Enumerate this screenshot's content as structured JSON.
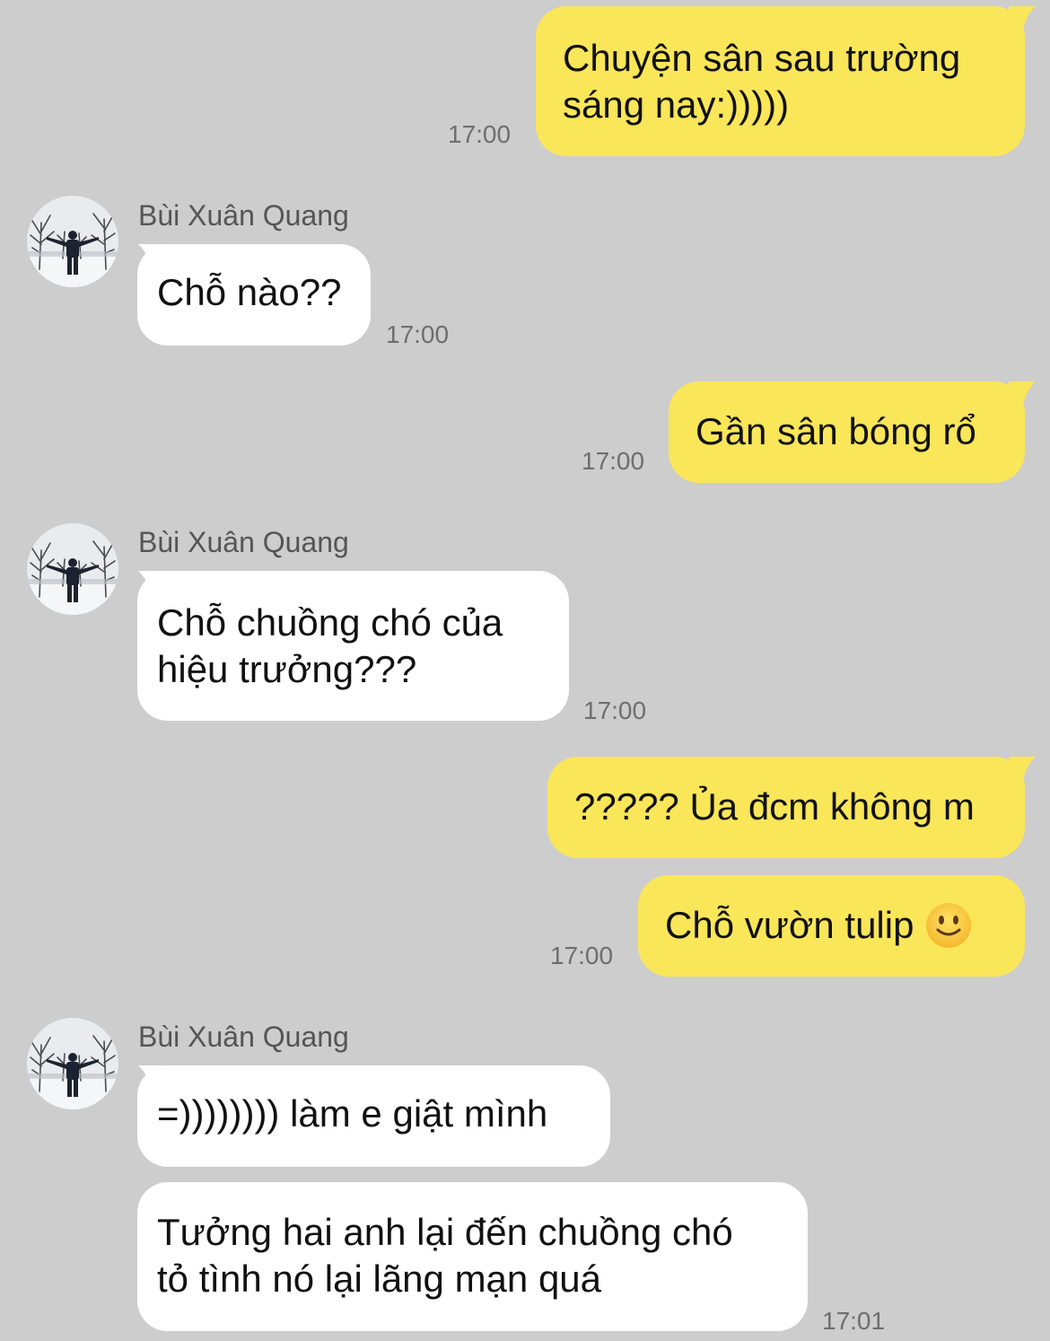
{
  "colors": {
    "background": "#cdcdcd",
    "outgoing_bubble": "#fae659",
    "incoming_bubble": "#ffffff",
    "timestamp": "#6e6e6e",
    "sender_name": "#555555"
  },
  "messages": {
    "m1": {
      "line1": "Chuyện sân sau trường",
      "line2": "sáng nay:)))))",
      "time": "17:00"
    },
    "sender1": "Bùi Xuân Quang",
    "m2": {
      "text": "Chỗ nào??",
      "time": "17:00"
    },
    "m3": {
      "text": "Gần sân bóng rổ",
      "time": "17:00"
    },
    "sender2": "Bùi Xuân Quang",
    "m4": {
      "line1": "Chỗ chuồng chó của",
      "line2": "hiệu trưởng???",
      "time": "17:00"
    },
    "m5": {
      "text": "????? Ủa đcm không m"
    },
    "m6": {
      "text": "Chỗ vườn tulip",
      "emoji": "slightly-smiling-face-icon",
      "time": "17:00"
    },
    "sender3": "Bùi Xuân Quang",
    "m7": {
      "text": "=)))))))) làm e giật mình"
    },
    "m8": {
      "line1": "Tưởng hai anh lại đến chuồng chó",
      "line2": "tỏ tình nó lại lãng mạn quá",
      "time": "17:01"
    }
  }
}
